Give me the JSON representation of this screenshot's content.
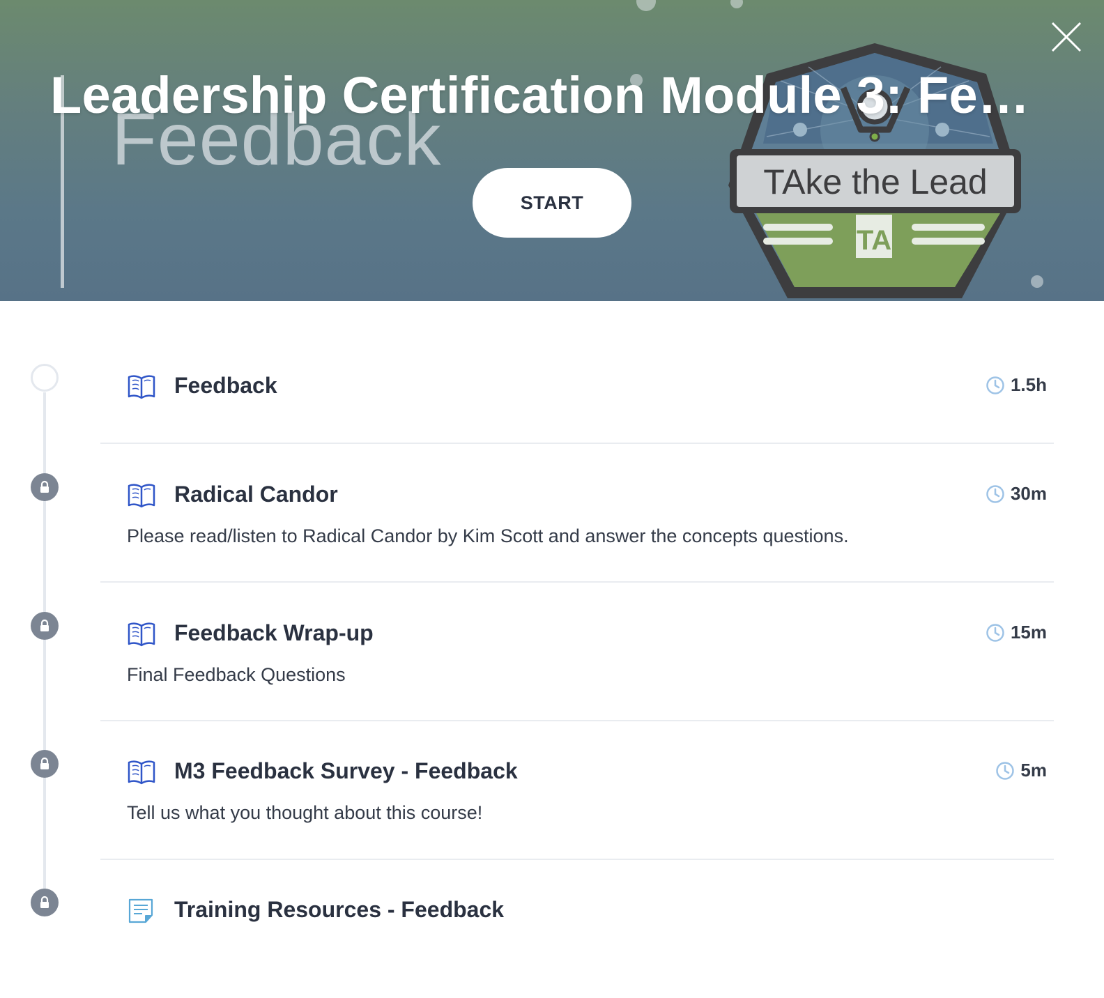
{
  "hero": {
    "title": "Leadership Certification Module 3: Feed...",
    "background_word": "Feedback",
    "badge_text": "TAke the Lead",
    "badge_monogram": "TA",
    "start_label": "START"
  },
  "steps": [
    {
      "title": "Feedback",
      "description": "",
      "duration": "1.5h",
      "state": "open",
      "icon": "book-icon"
    },
    {
      "title": "Radical Candor",
      "description": "Please read/listen to Radical Candor by Kim Scott and answer the concepts questions.",
      "duration": "30m",
      "state": "locked",
      "icon": "book-icon"
    },
    {
      "title": "Feedback Wrap-up",
      "description": "Final Feedback Questions",
      "duration": "15m",
      "state": "locked",
      "icon": "book-icon"
    },
    {
      "title": "M3 Feedback Survey - Feedback",
      "description": "Tell us what you thought about this course!",
      "duration": "5m",
      "state": "locked",
      "icon": "book-icon"
    },
    {
      "title": "Training Resources - Feedback",
      "description": "",
      "duration": "",
      "state": "locked",
      "icon": "document-icon"
    }
  ],
  "colors": {
    "hero_top": "#6c8a6e",
    "hero_bottom": "#577287",
    "book_icon": "#2f55c8",
    "clock_icon": "#9ec3e6",
    "lock_circle": "#7c8593",
    "text": "#2a3140"
  }
}
